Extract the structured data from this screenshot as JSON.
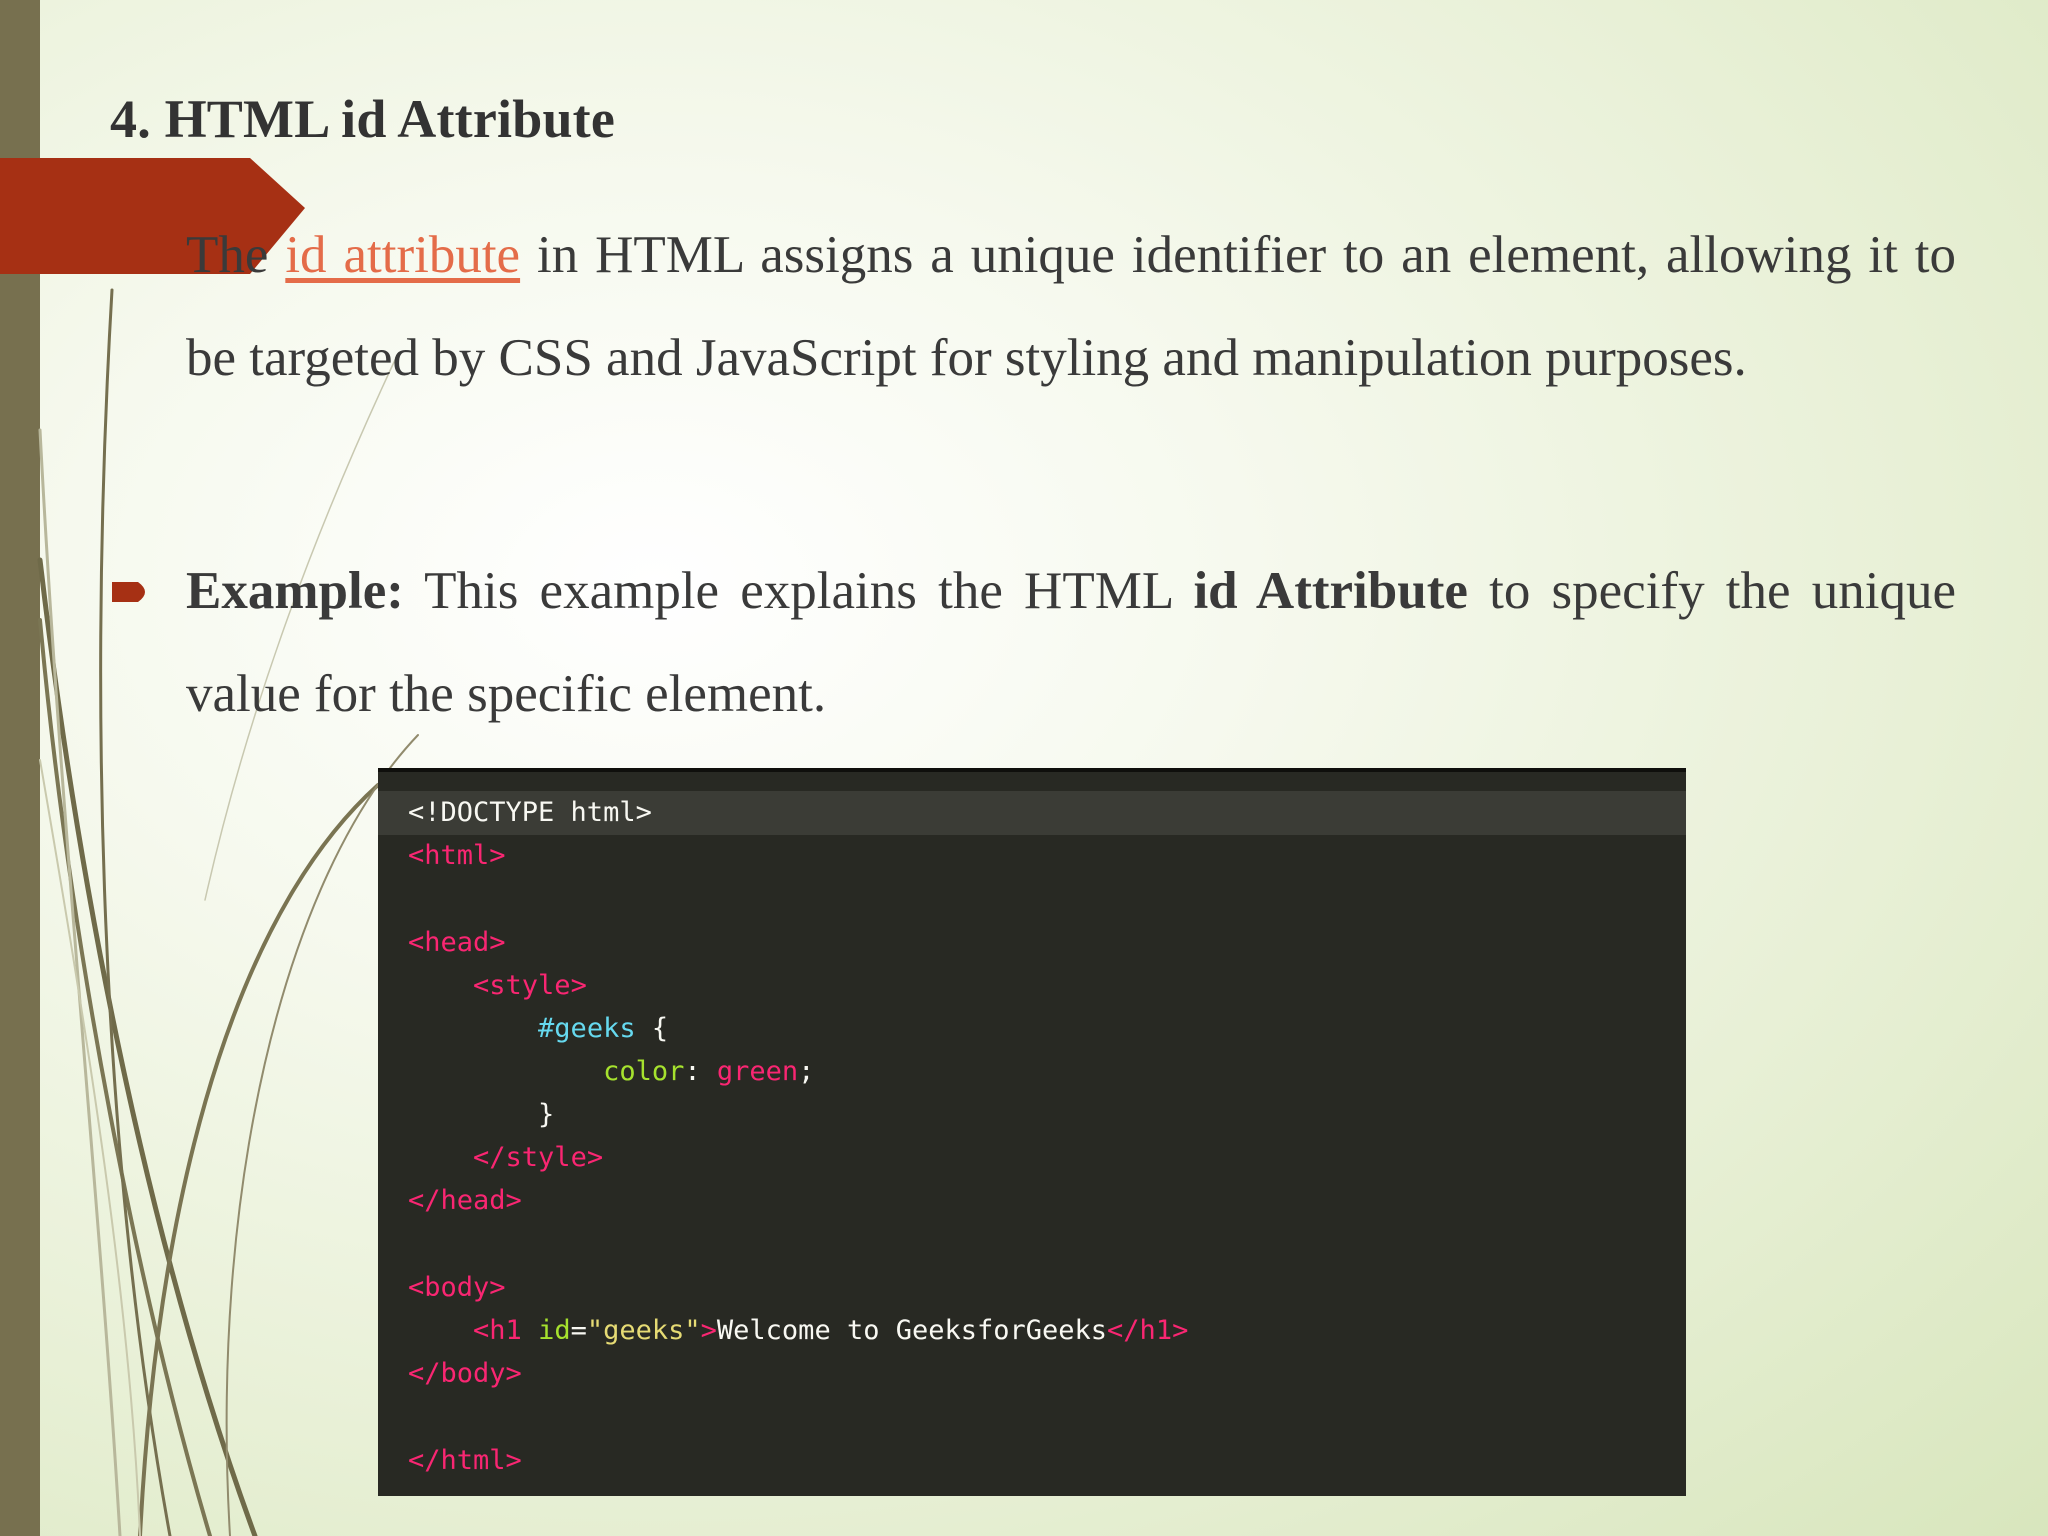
{
  "slide": {
    "title": "4. HTML id Attribute",
    "paragraph1": {
      "prefix": "The ",
      "link_text": "id attribute",
      "suffix": " in HTML assigns a unique identifier to an element, allowing it to be targeted by CSS and JavaScript for styling and manipulation purposes."
    },
    "bullet": {
      "label": "Example:",
      "text1": " This example explains the HTML ",
      "bold_text": "id Attribute",
      "text2": " to specify the unique value for the specific element."
    }
  },
  "code": {
    "doctype": "<!DOCTYPE html>",
    "html_open": "<html>",
    "head_open": "<head>",
    "style_open": "<style>",
    "selector": "#geeks",
    "brace_open": " {",
    "property": "color",
    "colon": ": ",
    "value": "green",
    "semicolon": ";",
    "brace_close": "}",
    "style_close": "</style>",
    "head_close": "</head>",
    "body_open": "<body>",
    "h1_open": "<h1 ",
    "attr_name": "id",
    "equals": "=",
    "attr_value": "\"geeks\"",
    "tag_end": ">",
    "h1_text": "Welcome to GeeksforGeeks",
    "h1_close": "</h1>",
    "body_close": "</body>",
    "html_close": "</html>"
  },
  "colors": {
    "sidebar": "#77704f",
    "accent": "#a63014",
    "link": "#e46c49",
    "code_bg": "#282923",
    "code_tag": "#f92672",
    "code_selector": "#66d9ef",
    "code_attr": "#a6e22e",
    "code_string": "#e6db74"
  }
}
